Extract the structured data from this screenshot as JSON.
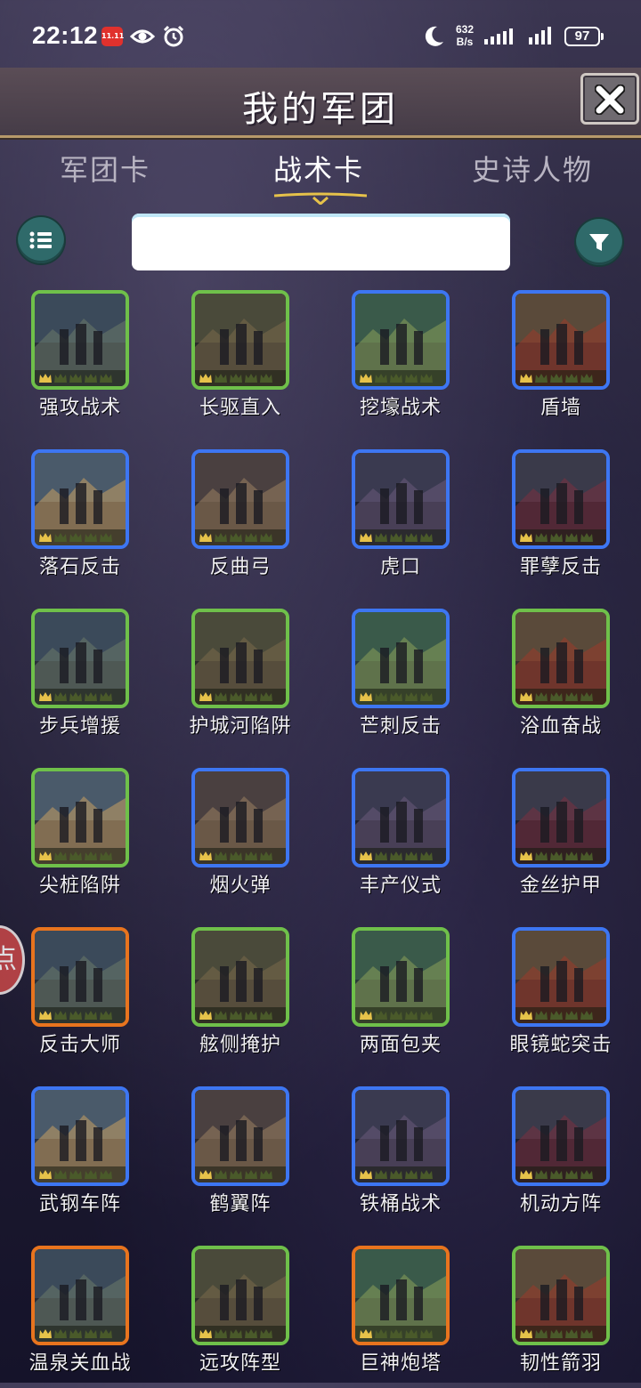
{
  "status_bar": {
    "time": "22:12",
    "badge": "11.11",
    "speed_value": "632",
    "speed_unit": "B/s",
    "battery": "97",
    "icons": [
      "eye-icon",
      "alarm-icon",
      "moon-icon",
      "signal-icon",
      "battery-icon"
    ]
  },
  "header": {
    "title": "我的军团",
    "close_icon": "close-icon"
  },
  "tabs": [
    {
      "label": "军团卡",
      "active": false
    },
    {
      "label": "战术卡",
      "active": true
    },
    {
      "label": "史诗人物",
      "active": false
    }
  ],
  "toolbar": {
    "list_icon": "list-icon",
    "search_value": "",
    "search_placeholder": "",
    "filter_icon": "filter-icon"
  },
  "side_bubble": {
    "label": "点"
  },
  "colors": {
    "green_frame": "#6fc04a",
    "blue_frame": "#3d76f2",
    "orange_frame": "#e8741e",
    "accent_gold": "#e6c24a"
  },
  "cards": [
    {
      "name": "强攻战术",
      "rarity": "green"
    },
    {
      "name": "长驱直入",
      "rarity": "green"
    },
    {
      "name": "挖壕战术",
      "rarity": "blue"
    },
    {
      "name": "盾墙",
      "rarity": "blue"
    },
    {
      "name": "落石反击",
      "rarity": "blue"
    },
    {
      "name": "反曲弓",
      "rarity": "blue"
    },
    {
      "name": "虎口",
      "rarity": "blue"
    },
    {
      "name": "罪孽反击",
      "rarity": "blue"
    },
    {
      "name": "步兵增援",
      "rarity": "green"
    },
    {
      "name": "护城河陷阱",
      "rarity": "green"
    },
    {
      "name": "芒刺反击",
      "rarity": "blue"
    },
    {
      "name": "浴血奋战",
      "rarity": "green"
    },
    {
      "name": "尖桩陷阱",
      "rarity": "green"
    },
    {
      "name": "烟火弹",
      "rarity": "blue"
    },
    {
      "name": "丰产仪式",
      "rarity": "blue"
    },
    {
      "name": "金丝护甲",
      "rarity": "blue"
    },
    {
      "name": "反击大师",
      "rarity": "orange"
    },
    {
      "name": "舷侧掩护",
      "rarity": "green"
    },
    {
      "name": "两面包夹",
      "rarity": "green"
    },
    {
      "name": "眼镜蛇突击",
      "rarity": "blue"
    },
    {
      "name": "武钢车阵",
      "rarity": "blue"
    },
    {
      "name": "鹤翼阵",
      "rarity": "blue"
    },
    {
      "name": "铁桶战术",
      "rarity": "blue"
    },
    {
      "name": "机动方阵",
      "rarity": "blue"
    },
    {
      "name": "温泉关血战",
      "rarity": "orange"
    },
    {
      "name": "远攻阵型",
      "rarity": "green"
    },
    {
      "name": "巨神炮塔",
      "rarity": "orange"
    },
    {
      "name": "韧性箭羽",
      "rarity": "green"
    }
  ]
}
